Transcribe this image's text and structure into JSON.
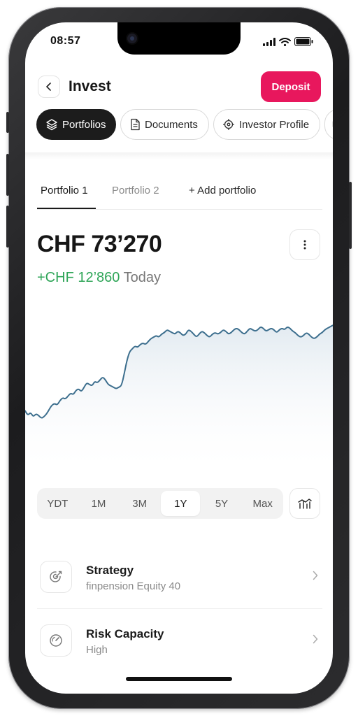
{
  "status_bar": {
    "time": "08:57"
  },
  "header": {
    "title": "Invest",
    "deposit_label": "Deposit"
  },
  "top_tabs": [
    {
      "label": "Portfolios",
      "icon": "layers-icon",
      "active": true
    },
    {
      "label": "Documents",
      "icon": "document-icon",
      "active": false
    },
    {
      "label": "Investor Profile",
      "icon": "target-icon",
      "active": false
    }
  ],
  "portfolio_tabs": {
    "items": [
      "Portfolio 1",
      "Portfolio 2"
    ],
    "add_label": "+ Add portfolio"
  },
  "summary": {
    "total": "CHF 73’270",
    "change": "+CHF 12’860",
    "period": "Today"
  },
  "chart_data": {
    "type": "area",
    "title": "",
    "xlabel": "",
    "ylabel": "",
    "x": [
      0,
      1,
      2,
      3,
      4,
      5,
      6,
      7,
      8,
      9,
      10,
      11,
      12,
      13,
      14,
      15,
      16,
      17,
      18,
      19,
      20,
      21,
      22,
      23,
      24,
      25,
      26,
      27,
      28,
      29,
      30,
      31,
      32,
      33,
      34,
      35,
      36,
      37,
      38,
      39,
      40,
      41,
      42,
      43,
      44,
      45,
      46,
      47,
      48,
      49,
      50,
      51,
      52,
      53,
      54,
      55,
      56,
      57,
      58,
      59,
      60,
      61,
      62,
      63,
      64,
      65,
      66,
      67,
      68,
      69,
      70,
      71,
      72,
      73,
      74,
      75,
      76,
      77,
      78,
      79,
      80,
      81,
      82,
      83,
      84,
      85,
      86,
      87,
      88,
      89,
      90,
      91,
      92,
      93,
      94,
      95,
      96,
      97,
      98,
      99,
      100,
      101,
      102,
      103,
      104,
      105,
      106,
      107,
      108,
      109,
      110,
      111,
      112,
      113,
      114,
      115
    ],
    "series": [
      {
        "values": [
          61,
          58,
          60,
          57,
          59,
          58,
          56,
          57,
          59,
          62,
          65,
          66,
          65,
          68,
          70,
          69,
          71,
          73,
          72,
          75,
          76,
          74,
          77,
          80,
          79,
          78,
          81,
          80,
          82,
          84,
          82,
          79,
          78,
          77,
          76,
          77,
          78,
          86,
          95,
          101,
          103,
          105,
          104,
          106,
          107,
          106,
          108,
          110,
          111,
          112,
          111,
          113,
          114,
          116,
          115,
          114,
          113,
          115,
          114,
          112,
          113,
          116,
          115,
          113,
          111,
          113,
          115,
          114,
          112,
          111,
          113,
          114,
          113,
          114,
          116,
          115,
          113,
          114,
          116,
          117,
          116,
          114,
          113,
          115,
          117,
          116,
          115,
          116,
          118,
          117,
          115,
          116,
          117,
          116,
          114,
          116,
          117,
          116,
          118,
          117,
          115,
          114,
          112,
          111,
          112,
          114,
          113,
          111,
          110,
          111,
          113,
          114,
          116,
          117,
          118,
          119
        ],
        "color": "#3d6f8e"
      }
    ],
    "ylim": [
      40,
      130
    ],
    "grid": false,
    "legend": "none"
  },
  "range_selector": {
    "options": [
      "YDT",
      "1M",
      "3M",
      "1Y",
      "5Y",
      "Max"
    ],
    "selected": "1Y"
  },
  "list": [
    {
      "title": "Strategy",
      "subtitle": "finpension Equity 40",
      "icon": "target-arrow-icon"
    },
    {
      "title": "Risk Capacity",
      "subtitle": "High",
      "icon": "gauge-icon"
    }
  ],
  "colors": {
    "accent": "#e8175d",
    "positive": "#2fa558",
    "chart_line": "#3d6f8e"
  }
}
